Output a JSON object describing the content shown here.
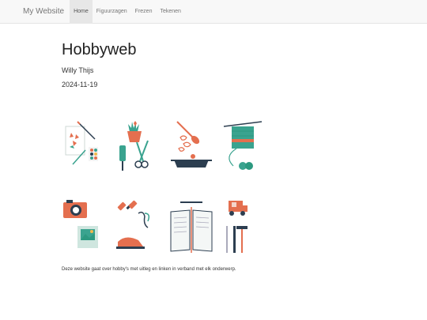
{
  "navbar": {
    "brand": "My Website",
    "items": [
      {
        "label": "Home",
        "active": true
      },
      {
        "label": "Figuurzagen",
        "active": false
      },
      {
        "label": "Frezen",
        "active": false
      },
      {
        "label": "Tekenen",
        "active": false
      }
    ]
  },
  "main": {
    "title": "Hobbyweb",
    "author": "Willy Thijs",
    "date": "2024-11-19",
    "description": "Deze website gaat over hobby's met uitleg en linken in verband met elk onderwerp."
  },
  "hobby_icons": [
    "painting-icon",
    "gardening-icon",
    "cooking-icon",
    "knitting-icon",
    "photography-icon",
    "fitness-icon",
    "reading-icon",
    "woodworking-icon"
  ],
  "colors": {
    "teal": "#3aa38f",
    "orange": "#e46f4f",
    "navy": "#2c3e50",
    "brand": "#777777",
    "active_bg": "#e7e7e7"
  }
}
